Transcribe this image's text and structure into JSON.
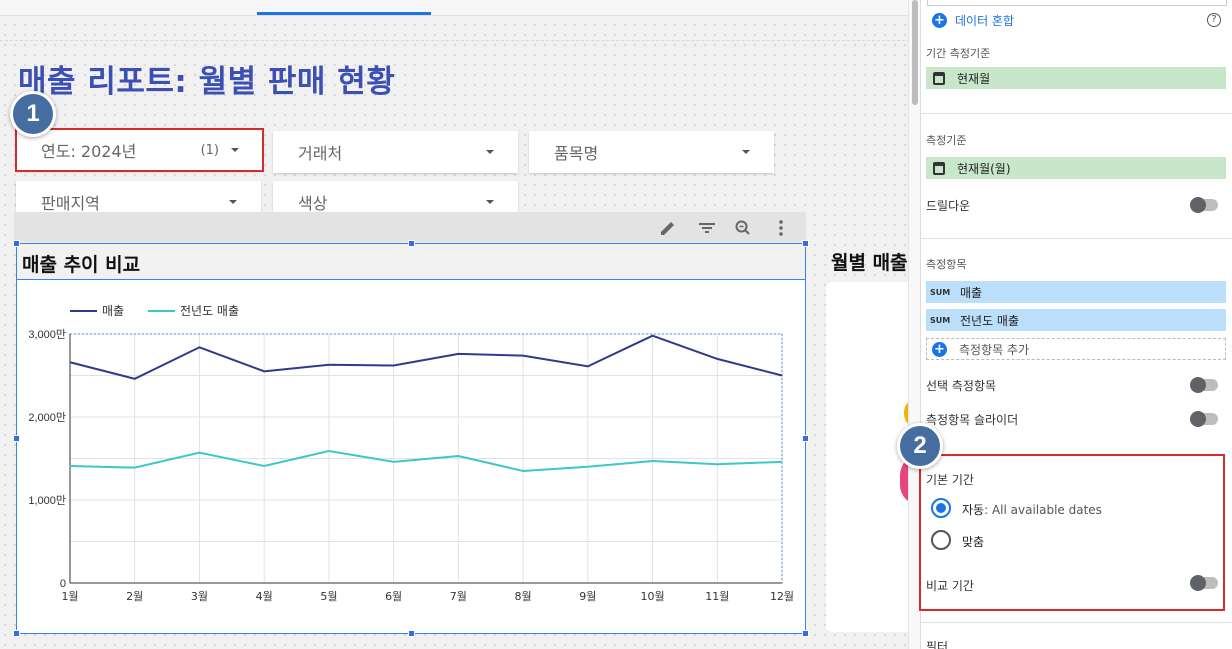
{
  "report": {
    "title": "매출 리포트: 월별 판매 현황"
  },
  "badges": {
    "one": "1",
    "two": "2"
  },
  "filters": [
    {
      "label": "연도: 2024년",
      "count": "(1)"
    },
    {
      "label": "거래처",
      "count": ""
    },
    {
      "label": "품목명",
      "count": ""
    },
    {
      "label": "판매지역",
      "count": ""
    },
    {
      "label": "색상",
      "count": ""
    }
  ],
  "chart_title": "매출 추이 비교",
  "right_chart_title": "월별 매출",
  "chart_data": {
    "type": "line",
    "categories": [
      "1월",
      "2월",
      "3월",
      "4월",
      "5월",
      "6월",
      "7월",
      "8월",
      "9월",
      "10월",
      "11월",
      "12월"
    ],
    "series": [
      {
        "name": "매출",
        "color": "#2e3a8c",
        "values": [
          2660,
          2460,
          2840,
          2550,
          2630,
          2620,
          2760,
          2740,
          2610,
          2980,
          2700,
          2500
        ]
      },
      {
        "name": "전년도 매출",
        "color": "#3ec7c9",
        "values": [
          1410,
          1390,
          1570,
          1410,
          1590,
          1460,
          1530,
          1350,
          1400,
          1470,
          1430,
          1460
        ]
      }
    ],
    "ylim": [
      0,
      3000
    ],
    "yticks": [
      "0",
      "1,000만",
      "2,000만",
      "3,000만"
    ],
    "grid": true,
    "legend": "top-left"
  },
  "panel": {
    "blend_label": "데이터 혼합",
    "date_dimension_label": "기간 측정기준",
    "date_dimension_value": "현재월",
    "dimension_label": "측정기준",
    "dimension_value": "현재월(월)",
    "drilldown_label": "드릴다운",
    "metrics_label": "측정항목",
    "metrics": [
      {
        "agg": "SUM",
        "name": "매출"
      },
      {
        "agg": "SUM",
        "name": "전년도 매출"
      }
    ],
    "add_metric_label": "측정항목 추가",
    "optional_metrics_label": "선택 측정항목",
    "metric_slider_label": "측정항목 슬라이더",
    "default_range_label": "기본 기간",
    "auto_label": "자동",
    "auto_sub": ": All available dates",
    "custom_label": "맞춤",
    "comparison_label": "비교 기간",
    "filter_label": "필터"
  }
}
